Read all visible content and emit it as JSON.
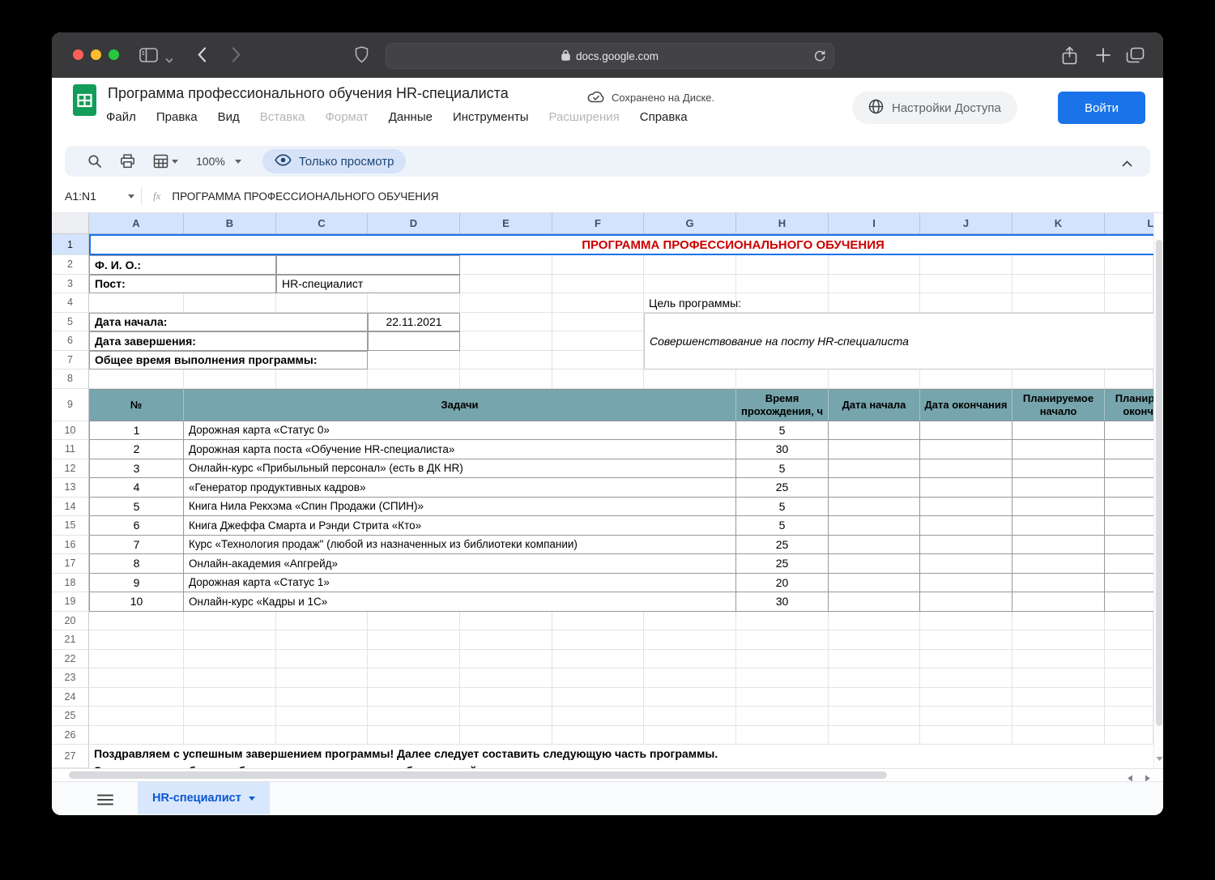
{
  "browser": {
    "url": "docs.google.com"
  },
  "header": {
    "doc_title": "Программа профессионального обучения HR-специалиста",
    "saved_status": "Сохранено на Диске.",
    "menus": [
      {
        "label": "Файл",
        "enabled": true
      },
      {
        "label": "Правка",
        "enabled": true
      },
      {
        "label": "Вид",
        "enabled": true
      },
      {
        "label": "Вставка",
        "enabled": false
      },
      {
        "label": "Формат",
        "enabled": false
      },
      {
        "label": "Данные",
        "enabled": true
      },
      {
        "label": "Инструменты",
        "enabled": true
      },
      {
        "label": "Расширения",
        "enabled": false
      },
      {
        "label": "Справка",
        "enabled": true
      }
    ],
    "share_button": "Настройки Доступа",
    "signin_button": "Войти"
  },
  "toolbar": {
    "zoom": "100%",
    "view_mode": "Только просмотр"
  },
  "formula_bar": {
    "cell_ref": "A1:N1",
    "value": "ПРОГРАММА ПРОФЕССИОНАЛЬНОГО ОБУЧЕНИЯ"
  },
  "sheet": {
    "columns": [
      "A",
      "B",
      "C",
      "D",
      "E",
      "F",
      "G",
      "H",
      "I",
      "J",
      "K",
      "L"
    ],
    "title": "ПРОГРАММА ПРОФЕССИОНАЛЬНОГО ОБУЧЕНИЯ",
    "info": {
      "fio_label": "Ф. И. О.:",
      "post_label": "Пост:",
      "post_value": "HR-специалист",
      "goal_label": "Цель программы:",
      "goal_value": "Совершенствование на посту HR-специалиста",
      "start_label": "Дата начала:",
      "start_value": "22.11.2021",
      "end_label": "Дата завершения:",
      "total_label": "Общее время выполнения программы:"
    },
    "table": {
      "headers": [
        "№",
        "Задачи",
        "Время прохождения, ч",
        "Дата начала",
        "Дата окончания",
        "Планируемое начало",
        "Планируемое окончание"
      ],
      "rows": [
        {
          "num": "1",
          "task": "Дорожная карта «Статус 0»",
          "hours": "5"
        },
        {
          "num": "2",
          "task": "Дорожная карта поста «Обучение HR-специалиста»",
          "hours": "30"
        },
        {
          "num": "3",
          "task": "Онлайн-курс «Прибыльный персонал» (есть в ДК HR)",
          "hours": "5"
        },
        {
          "num": "4",
          "task": "«Генератор продуктивных кадров»",
          "hours": "25"
        },
        {
          "num": "5",
          "task": "Книга Нила Рекхэма «Спин Продажи (СПИН)»",
          "hours": "5"
        },
        {
          "num": "6",
          "task": "Книга Джеффа Смарта и Рэнди Стрита «Кто»",
          "hours": "5"
        },
        {
          "num": "7",
          "task": "Курс «Технология продаж\" (любой из назначенных из библиотеки компании)",
          "hours": "25"
        },
        {
          "num": "8",
          "task": "Онлайн-академия «Апгрейд»",
          "hours": "25"
        },
        {
          "num": "9",
          "task": "Дорожная карта «Статус 1»",
          "hours": "20"
        },
        {
          "num": "10",
          "task": "Онлайн-курс «Кадры и 1С»",
          "hours": "30"
        }
      ]
    },
    "footer": "Поздравляем с успешным завершением программы! Далее следует составить следующую часть программы.",
    "footer_line2_clipped": "Эта программа обучения была составлена на основе обязанностей поста и материалов компании"
  },
  "tabs": {
    "active": "HR-специалист"
  },
  "colors": {
    "accent_blue": "#1a73e8",
    "selection_blue": "#1a73e8",
    "title_red": "#cc0000",
    "table_header_teal": "#76a5ad",
    "column_header_bg": "#d3e3fd",
    "active_tab_bg": "#d9e7fd",
    "view_chip_bg": "#d6e2f7"
  }
}
